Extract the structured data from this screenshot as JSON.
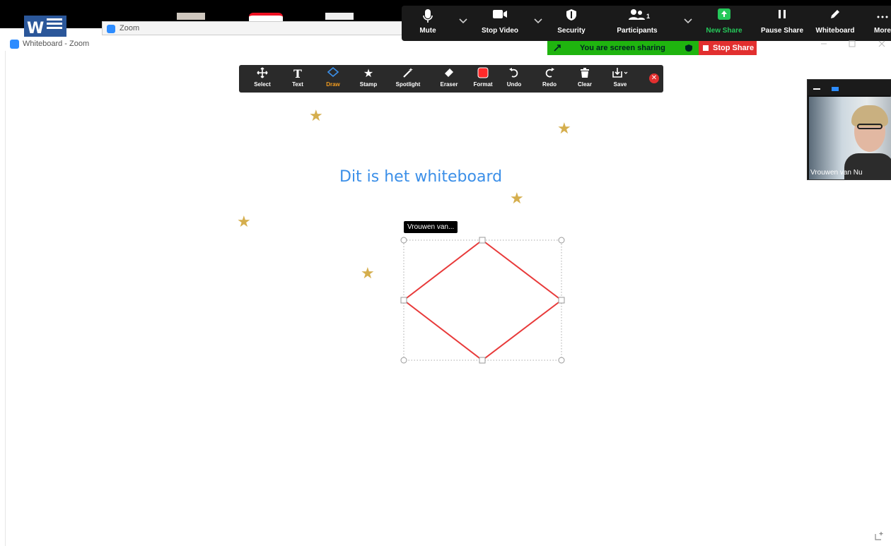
{
  "taskbar": {
    "zoom_tab_label": "Zoom"
  },
  "controls": {
    "mute_label": "Mute",
    "stop_video_label": "Stop Video",
    "security_label": "Security",
    "participants_label": "Participants",
    "participants_count": "1",
    "new_share_label": "New Share",
    "pause_share_label": "Pause Share",
    "whiteboard_label": "Whiteboard",
    "more_label": "More"
  },
  "sharing": {
    "banner_text": "You are screen sharing",
    "stop_share_label": "Stop Share"
  },
  "window": {
    "title": "Whiteboard - Zoom"
  },
  "toolbar": {
    "tools": [
      {
        "label": "Select"
      },
      {
        "label": "Text"
      },
      {
        "label": "Draw"
      },
      {
        "label": "Stamp"
      },
      {
        "label": "Spotlight"
      },
      {
        "label": "Eraser"
      },
      {
        "label": "Format"
      },
      {
        "label": "Undo"
      },
      {
        "label": "Redo"
      },
      {
        "label": "Clear"
      },
      {
        "label": "Save"
      }
    ],
    "active_tool": "Draw",
    "format_color": "#ff2a2a"
  },
  "canvas": {
    "heading": "Dit is het whiteboard",
    "annotator_tooltip": "Vrouwen van...",
    "shape_color": "#e83a3a",
    "text_color": "#3b8fe8",
    "stamp_color": "#d5ae4d"
  },
  "video": {
    "participant_name": "Vrouwen van Nu"
  }
}
